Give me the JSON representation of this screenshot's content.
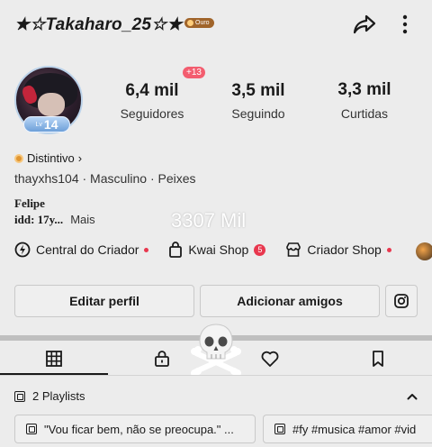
{
  "profile": {
    "username": "★☆Takaharo_25☆★",
    "rank_badge": "Ouro",
    "level_prefix": "Lv",
    "level": "14",
    "new_followers_badge": "+13"
  },
  "stats": [
    {
      "value": "6,4 mil",
      "label": "Seguidores"
    },
    {
      "value": "3,5 mil",
      "label": "Seguindo"
    },
    {
      "value": "3,3 mil",
      "label": "Curtidas"
    }
  ],
  "distintivo": {
    "label": "Distintivo",
    "chevron": "›"
  },
  "info_line": "thayxhs104 · Masculino · Peixes",
  "bio": {
    "line1": "Felipe",
    "line2": "idd: 17y...",
    "more": "Mais"
  },
  "overlay_count": "3307 Mil",
  "links": [
    {
      "label": "Central do Criador",
      "icon": "creator-center-icon",
      "badge_type": "dot",
      "badge": ""
    },
    {
      "label": "Kwai Shop",
      "icon": "shopping-bag-icon",
      "badge_type": "number",
      "badge": "5"
    },
    {
      "label": "Criador Shop",
      "icon": "store-icon",
      "badge_type": "dot",
      "badge": ""
    }
  ],
  "buttons": {
    "edit_profile": "Editar perfil",
    "add_friends": "Adicionar amigos",
    "instagram_icon": "instagram-icon"
  },
  "tabs": [
    {
      "name": "grid-icon",
      "active": true
    },
    {
      "name": "lock-icon",
      "active": false
    },
    {
      "name": "heart-icon",
      "active": false
    },
    {
      "name": "bookmark-icon",
      "active": false
    }
  ],
  "overlay_emoji": "skull-crossbones",
  "playlists": {
    "header": "2 Playlists",
    "items": [
      "\"Vou ficar bem, não se preocupa.\" ...",
      "#fy #musica #amor #vid"
    ]
  },
  "colors": {
    "background": "#ececec",
    "accent_red": "#e8374e",
    "rank_badge": "#a0642a",
    "level_badge": "#6d9fd8"
  }
}
